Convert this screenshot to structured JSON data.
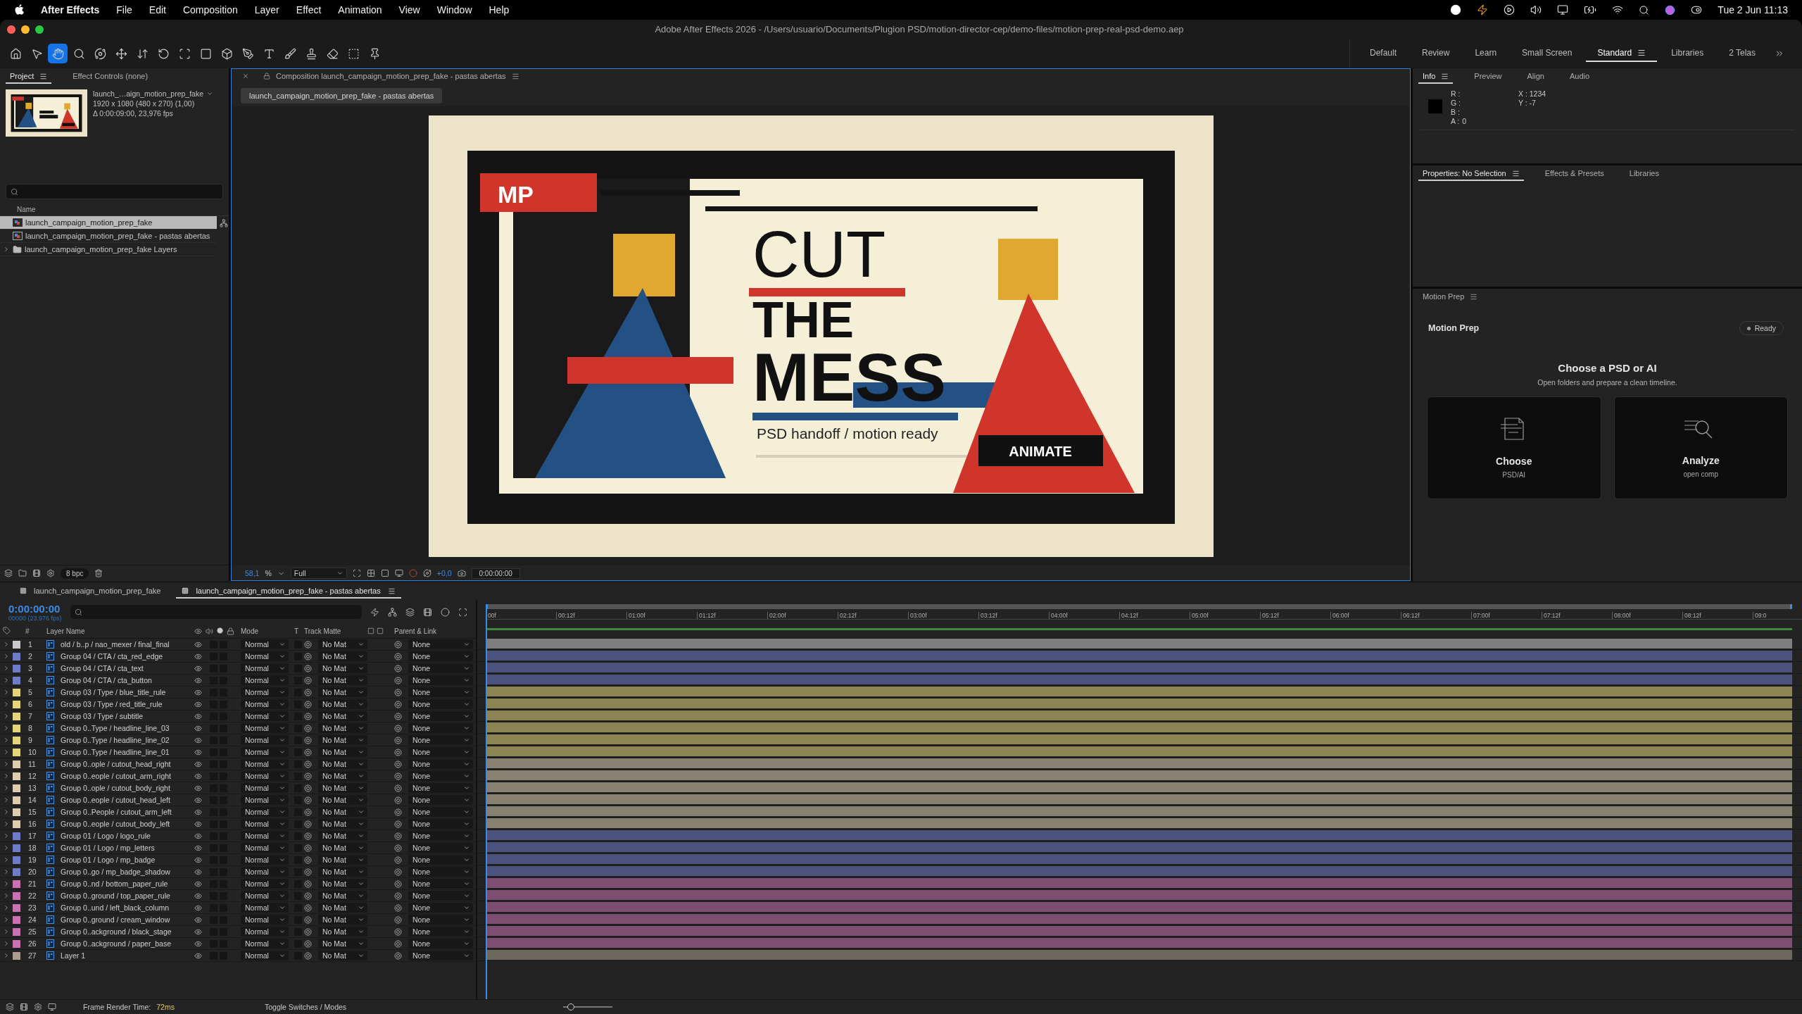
{
  "menu_bar": {
    "app": "After Effects",
    "items": [
      "File",
      "Edit",
      "Composition",
      "Layer",
      "Effect",
      "Animation",
      "View",
      "Window",
      "Help"
    ],
    "clock": "Tue 2 Jun  11:13"
  },
  "window": {
    "title": "Adobe After Effects 2026 - /Users/usuario/Documents/Plugion PSD/motion-director-cep/demo-files/motion-prep-real-psd-demo.aep"
  },
  "toolbar": {
    "tools": [
      {
        "kind": "home",
        "selected": false
      },
      {
        "kind": "select",
        "selected": false
      },
      {
        "kind": "hand",
        "selected": true
      },
      {
        "kind": "zoom",
        "selected": false
      },
      {
        "kind": "orbit",
        "selected": false
      },
      {
        "kind": "pan",
        "selected": false
      },
      {
        "kind": "dolly",
        "selected": false
      },
      {
        "kind": "rotate",
        "selected": false
      },
      {
        "kind": "anchor",
        "selected": false
      },
      {
        "kind": "shape",
        "selected": false
      },
      {
        "kind": "cube",
        "selected": false
      },
      {
        "kind": "pen",
        "selected": false
      },
      {
        "kind": "type",
        "selected": false
      },
      {
        "kind": "brush",
        "selected": false
      },
      {
        "kind": "stamp",
        "selected": false
      },
      {
        "kind": "eraser",
        "selected": false
      },
      {
        "kind": "roto",
        "selected": false
      },
      {
        "kind": "pin",
        "selected": false
      }
    ],
    "workspaces": [
      {
        "label": "Default",
        "selected": false
      },
      {
        "label": "Review",
        "selected": false
      },
      {
        "label": "Learn",
        "selected": false
      },
      {
        "label": "Small Screen",
        "selected": false
      },
      {
        "label": "Standard",
        "selected": true
      },
      {
        "label": "Libraries",
        "selected": false
      },
      {
        "label": "2 Telas",
        "selected": false
      }
    ]
  },
  "project_panel": {
    "tabs": [
      {
        "label": "Project",
        "selected": true
      },
      {
        "label": "Effect Controls (none)",
        "selected": false
      }
    ],
    "preview": {
      "name": "launch_…aign_motion_prep_fake",
      "details": [
        "1920 x 1080  (480 x 270) (1,00)",
        "Δ 0:00:09:00, 23,976 fps"
      ]
    },
    "name_column": "Name",
    "items": [
      {
        "name": "launch_campaign_motion_prep_fake",
        "kind": "comp",
        "selected": true
      },
      {
        "name": "launch_campaign_motion_prep_fake - pastas abertas",
        "kind": "comp",
        "selected": false
      },
      {
        "name": "launch_campaign_motion_prep_fake Layers",
        "kind": "folder",
        "selected": false
      }
    ],
    "bit_depth": "8 bpc"
  },
  "composition_panel": {
    "tab": "Composition launch_campaign_motion_prep_fake - pastas abertas",
    "subtab": "launch_campaign_motion_prep_fake - pastas abertas",
    "artwork": {
      "badge": "MP",
      "headline": [
        "CUT",
        "THE",
        "MESS"
      ],
      "subtitle": "PSD handoff / motion ready",
      "button": "ANIMATE"
    },
    "footer": {
      "zoom": "58,1",
      "zoom_unit": "%",
      "resolution": "Full",
      "exposure": "+0,0",
      "timecode": "0:00:00:00"
    }
  },
  "info_panel": {
    "tabs": [
      {
        "label": "Info",
        "selected": true
      },
      {
        "label": "Preview",
        "selected": false
      },
      {
        "label": "Align",
        "selected": false
      },
      {
        "label": "Audio",
        "selected": false
      }
    ],
    "channels": [
      "R :",
      "G :",
      "B :",
      "A :"
    ],
    "alpha": "0",
    "position": [
      "X : 1234",
      "Y : -7"
    ]
  },
  "properties_panel": {
    "tabs": [
      {
        "label": "Properties: No Selection",
        "selected": true
      },
      {
        "label": "Effects & Presets",
        "selected": false
      },
      {
        "label": "Libraries",
        "selected": false
      }
    ]
  },
  "motion_prep": {
    "tab": "Motion Prep",
    "title": "Motion Prep",
    "status": "Ready",
    "heading": "Choose a PSD or AI",
    "subheading": "Open folders and prepare a clean timeline.",
    "cards": [
      {
        "kind": "choose",
        "title": "Choose",
        "subtitle": "PSD/AI"
      },
      {
        "kind": "analyze",
        "title": "Analyze",
        "subtitle": "open comp"
      }
    ]
  },
  "timeline": {
    "tabs": [
      {
        "label": "launch_campaign_motion_prep_fake",
        "selected": false
      },
      {
        "label": "launch_campaign_motion_prep_fake - pastas abertas",
        "selected": true
      }
    ],
    "timecode": "0:00:00:00",
    "frame_info": "00000 (23.976 fps)",
    "columns": {
      "number": "#",
      "name": "Layer Name",
      "mode": "Mode",
      "t": "T",
      "matte": "Track Matte",
      "parent": "Parent & Link"
    },
    "ruler": [
      "00f",
      "00:12f",
      "01:00f",
      "01:12f",
      "02:00f",
      "02:12f",
      "03:00f",
      "03:12f",
      "04:00f",
      "04:12f",
      "05:00f",
      "05:12f",
      "06:00f",
      "06:12f",
      "07:00f",
      "07:12f",
      "08:00f",
      "08:12f",
      "09:0"
    ],
    "layers": [
      {
        "number": "1",
        "name": "old / b..p / nao_mexer / final_final",
        "color": "#c9c9c9",
        "solo": false,
        "locked": false,
        "preserve_transparency": false,
        "mode": "Normal",
        "matte": "No Mat",
        "parent": "None"
      },
      {
        "number": "2",
        "name": "Group 04 / CTA / cta_red_edge",
        "color": "#6f7dc7",
        "solo": false,
        "locked": false,
        "preserve_transparency": false,
        "mode": "Normal",
        "matte": "No Mat",
        "parent": "None"
      },
      {
        "number": "3",
        "name": "Group 04 / CTA / cta_text",
        "color": "#6f7dc7",
        "solo": false,
        "locked": false,
        "preserve_transparency": false,
        "mode": "Normal",
        "matte": "No Mat",
        "parent": "None"
      },
      {
        "number": "4",
        "name": "Group 04 / CTA / cta_button",
        "color": "#6f7dc7",
        "solo": false,
        "locked": false,
        "preserve_transparency": false,
        "mode": "Normal",
        "matte": "No Mat",
        "parent": "None"
      },
      {
        "number": "5",
        "name": "Group 03 / Type / blue_title_rule",
        "color": "#e4d47c",
        "solo": false,
        "locked": false,
        "preserve_transparency": false,
        "mode": "Normal",
        "matte": "No Mat",
        "parent": "None"
      },
      {
        "number": "6",
        "name": "Group 03 / Type / red_title_rule",
        "color": "#e4d47c",
        "solo": false,
        "locked": false,
        "preserve_transparency": false,
        "mode": "Normal",
        "matte": "No Mat",
        "parent": "None"
      },
      {
        "number": "7",
        "name": "Group 03 / Type / subtitle",
        "color": "#e4d47c",
        "solo": false,
        "locked": false,
        "preserve_transparency": false,
        "mode": "Normal",
        "matte": "No Mat",
        "parent": "None"
      },
      {
        "number": "8",
        "name": "Group 0..Type / headline_line_03",
        "color": "#e4d47c",
        "solo": false,
        "locked": false,
        "preserve_transparency": false,
        "mode": "Normal",
        "matte": "No Mat",
        "parent": "None"
      },
      {
        "number": "9",
        "name": "Group 0..Type / headline_line_02",
        "color": "#e4d47c",
        "solo": false,
        "locked": false,
        "preserve_transparency": false,
        "mode": "Normal",
        "matte": "No Mat",
        "parent": "None"
      },
      {
        "number": "10",
        "name": "Group 0..Type / headline_line_01",
        "color": "#e4d47c",
        "solo": false,
        "locked": false,
        "preserve_transparency": false,
        "mode": "Normal",
        "matte": "No Mat",
        "parent": "None"
      },
      {
        "number": "11",
        "name": "Group 0..ople / cutout_head_right",
        "color": "#dccdb0",
        "solo": false,
        "locked": false,
        "preserve_transparency": false,
        "mode": "Normal",
        "matte": "No Mat",
        "parent": "None"
      },
      {
        "number": "12",
        "name": "Group 0..eople / cutout_arm_right",
        "color": "#dccdb0",
        "solo": false,
        "locked": false,
        "preserve_transparency": false,
        "mode": "Normal",
        "matte": "No Mat",
        "parent": "None"
      },
      {
        "number": "13",
        "name": "Group 0..ople / cutout_body_right",
        "color": "#dccdb0",
        "solo": false,
        "locked": false,
        "preserve_transparency": false,
        "mode": "Normal",
        "matte": "No Mat",
        "parent": "None"
      },
      {
        "number": "14",
        "name": "Group 0..eople / cutout_head_left",
        "color": "#dccdb0",
        "solo": false,
        "locked": false,
        "preserve_transparency": false,
        "mode": "Normal",
        "matte": "No Mat",
        "parent": "None"
      },
      {
        "number": "15",
        "name": "Group 0..People / cutout_arm_left",
        "color": "#dccdb0",
        "solo": false,
        "locked": false,
        "preserve_transparency": false,
        "mode": "Normal",
        "matte": "No Mat",
        "parent": "None"
      },
      {
        "number": "16",
        "name": "Group 0..eople / cutout_body_left",
        "color": "#dccdb0",
        "solo": false,
        "locked": false,
        "preserve_transparency": false,
        "mode": "Normal",
        "matte": "No Mat",
        "parent": "None"
      },
      {
        "number": "17",
        "name": "Group 01 / Logo / logo_rule",
        "color": "#6f7dc7",
        "solo": false,
        "locked": false,
        "preserve_transparency": false,
        "mode": "Normal",
        "matte": "No Mat",
        "parent": "None"
      },
      {
        "number": "18",
        "name": "Group 01 / Logo / mp_letters",
        "color": "#6f7dc7",
        "solo": false,
        "locked": false,
        "preserve_transparency": false,
        "mode": "Normal",
        "matte": "No Mat",
        "parent": "None"
      },
      {
        "number": "19",
        "name": "Group 01 / Logo / mp_badge",
        "color": "#6f7dc7",
        "solo": false,
        "locked": false,
        "preserve_transparency": false,
        "mode": "Normal",
        "matte": "No Mat",
        "parent": "None"
      },
      {
        "number": "20",
        "name": "Group 0..go / mp_badge_shadow",
        "color": "#6f7dc7",
        "solo": false,
        "locked": false,
        "preserve_transparency": false,
        "mode": "Normal",
        "matte": "No Mat",
        "parent": "None"
      },
      {
        "number": "21",
        "name": "Group 0..nd / bottom_paper_rule",
        "color": "#c872b4",
        "solo": false,
        "locked": false,
        "preserve_transparency": false,
        "mode": "Normal",
        "matte": "No Mat",
        "parent": "None"
      },
      {
        "number": "22",
        "name": "Group 0..ground / top_paper_rule",
        "color": "#c872b4",
        "solo": false,
        "locked": false,
        "preserve_transparency": false,
        "mode": "Normal",
        "matte": "No Mat",
        "parent": "None"
      },
      {
        "number": "23",
        "name": "Group 0..und / left_black_column",
        "color": "#c872b4",
        "solo": false,
        "locked": false,
        "preserve_transparency": false,
        "mode": "Normal",
        "matte": "No Mat",
        "parent": "None"
      },
      {
        "number": "24",
        "name": "Group 0..ground / cream_window",
        "color": "#c872b4",
        "solo": false,
        "locked": false,
        "preserve_transparency": false,
        "mode": "Normal",
        "matte": "No Mat",
        "parent": "None"
      },
      {
        "number": "25",
        "name": "Group 0..ackground / black_stage",
        "color": "#c872b4",
        "solo": false,
        "locked": false,
        "preserve_transparency": false,
        "mode": "Normal",
        "matte": "No Mat",
        "parent": "None"
      },
      {
        "number": "26",
        "name": "Group 0..ackground / paper_base",
        "color": "#c872b4",
        "solo": false,
        "locked": false,
        "preserve_transparency": false,
        "mode": "Normal",
        "matte": "No Mat",
        "parent": "None"
      },
      {
        "number": "27",
        "name": "Layer 1",
        "color": "#aa9f8e",
        "solo": false,
        "locked": false,
        "preserve_transparency": false,
        "mode": "Normal",
        "matte": "No Mat",
        "parent": "None"
      }
    ],
    "footer": {
      "render_label": "Frame Render Time:",
      "render_value": "72ms",
      "toggle": "Toggle Switches / Modes",
      "zoom_slider": {
        "level": 0.15
      }
    }
  }
}
